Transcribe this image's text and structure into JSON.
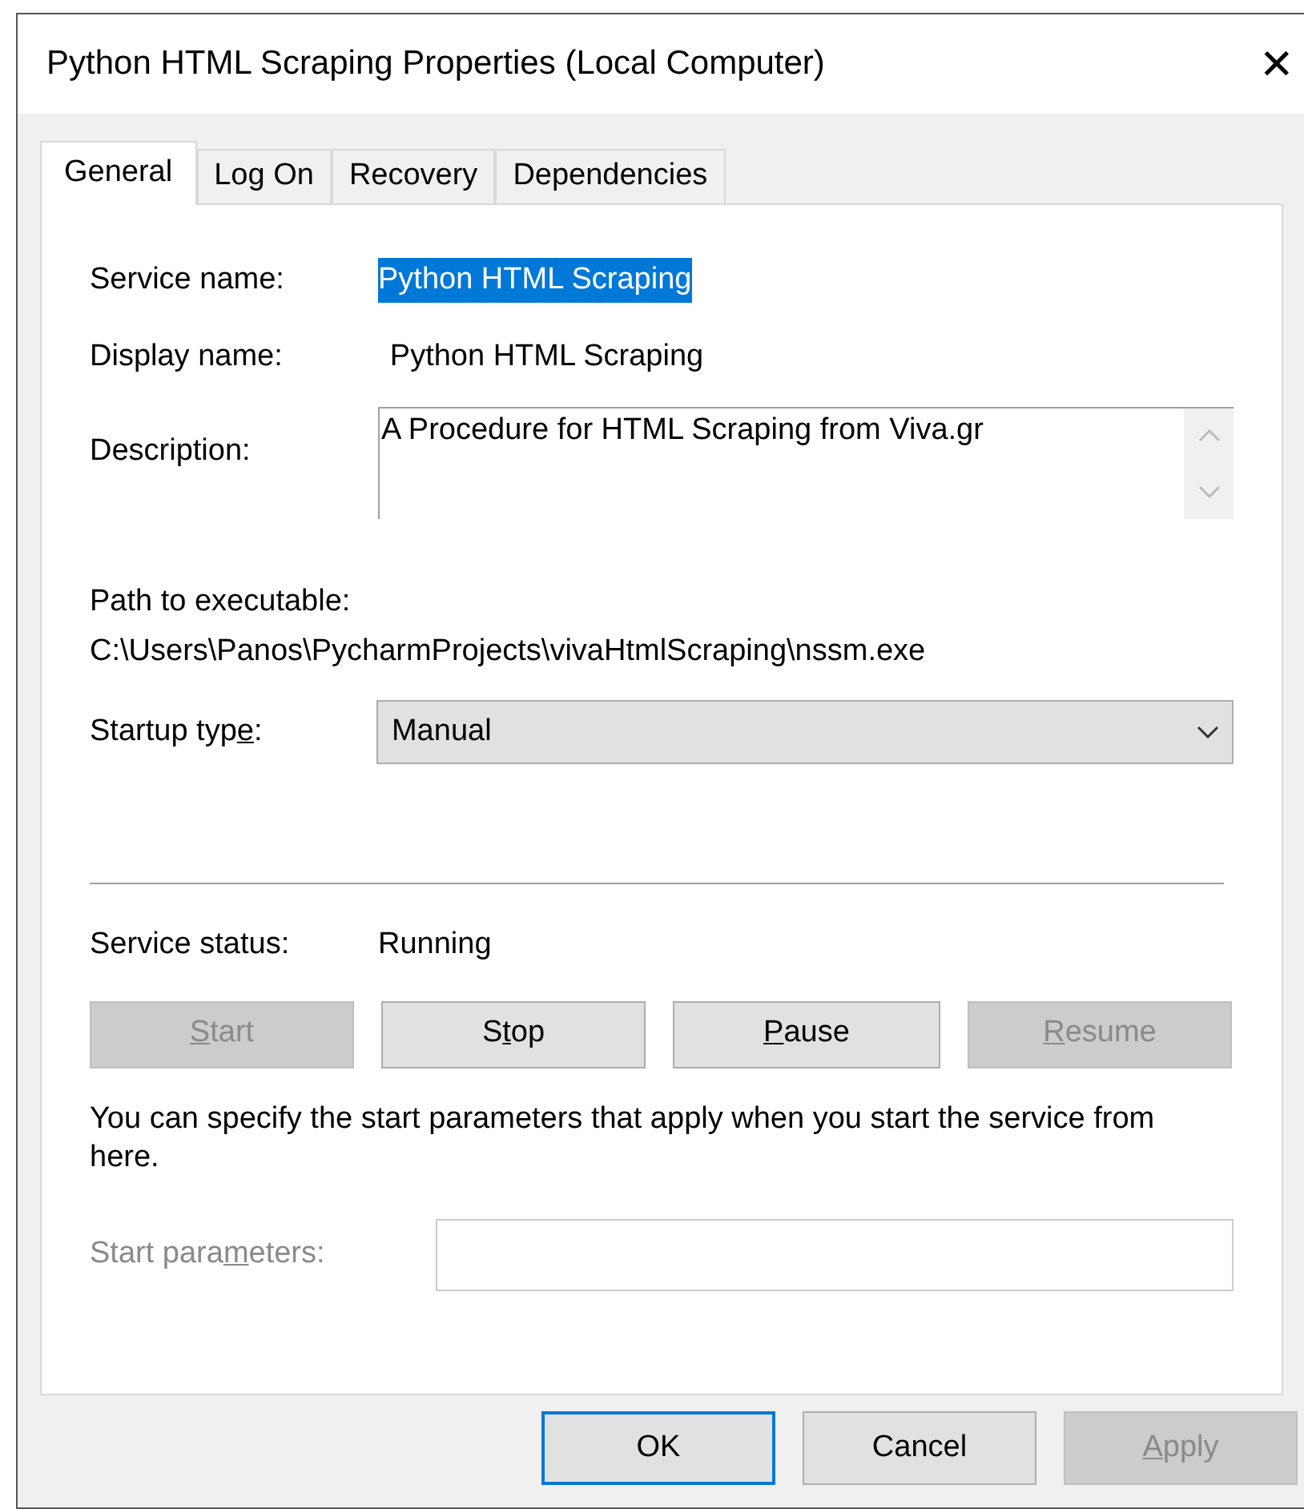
{
  "window": {
    "title": "Python HTML Scraping Properties (Local Computer)",
    "close": "✕"
  },
  "tabs": [
    {
      "label": "General",
      "selected": true
    },
    {
      "label": "Log On",
      "selected": false
    },
    {
      "label": "Recovery",
      "selected": false
    },
    {
      "label": "Dependencies",
      "selected": false
    }
  ],
  "service_name": {
    "label": "Service name:",
    "value": "Python HTML Scraping",
    "selected": true
  },
  "display_name": {
    "label": "Display name:",
    "value": "Python HTML Scraping"
  },
  "description": {
    "label": "Description:",
    "value": "A Procedure for HTML Scraping from Viva.gr"
  },
  "path": {
    "label": "Path to executable:",
    "value": "C:\\Users\\Panos\\PycharmProjects\\vivaHtmlScraping\\nssm.exe"
  },
  "startup_type": {
    "label": {
      "before": "Startup typ",
      "key": "e",
      "after": ":"
    },
    "value": "Manual"
  },
  "service_status": {
    "label": "Service status:",
    "value": "Running"
  },
  "service_buttons": [
    {
      "label": {
        "key": "S",
        "after": "tart"
      },
      "disabled": true
    },
    {
      "label": {
        "before": "S",
        "key": "t",
        "after": "op"
      },
      "disabled": false
    },
    {
      "label": {
        "key": "P",
        "after": "ause"
      },
      "disabled": false
    },
    {
      "label": {
        "key": "R",
        "after": "esume"
      },
      "disabled": true
    }
  ],
  "note": "You can specify the start parameters that apply when you start the service from here.",
  "start_parameters": {
    "label": {
      "before": "Start para",
      "key": "m",
      "after": "eters:"
    },
    "disabled": true
  },
  "dialog_buttons": [
    {
      "label": {
        "before": "OK"
      },
      "disabled": false,
      "default": true
    },
    {
      "label": {
        "before": "Cancel"
      },
      "disabled": false,
      "default": false
    },
    {
      "label": {
        "key": "A",
        "after": "pply"
      },
      "disabled": true,
      "default": false
    }
  ]
}
